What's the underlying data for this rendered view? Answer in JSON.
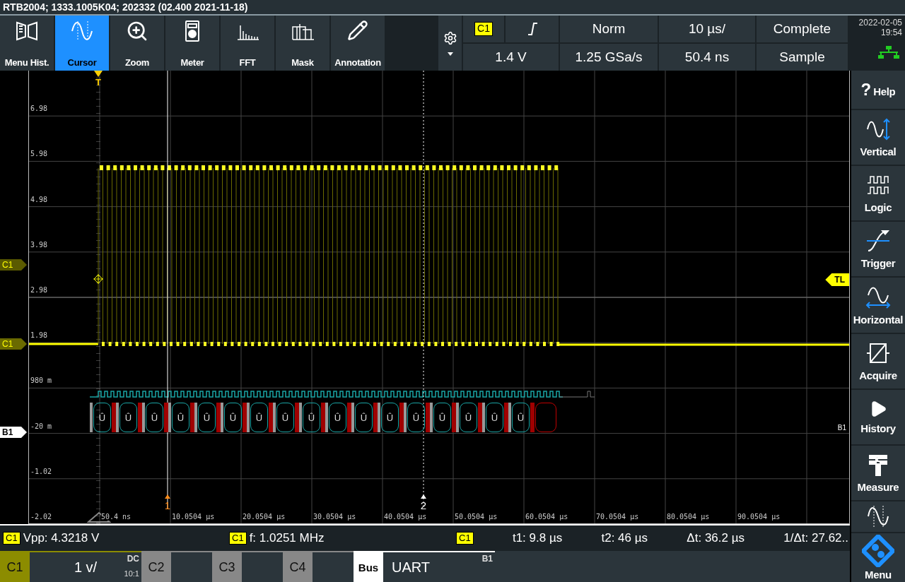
{
  "title_bar": {
    "text": "RTB2004; 1333.1005K04; 202332 (02.400 2021-11-18)"
  },
  "toolbar": {
    "tools": [
      {
        "label": "Menu Hist.",
        "selected": false
      },
      {
        "label": "Cursor",
        "selected": true
      },
      {
        "label": "Zoom",
        "selected": false
      },
      {
        "label": "Meter",
        "selected": false
      },
      {
        "label": "FFT",
        "selected": false
      },
      {
        "label": "Mask",
        "selected": false
      },
      {
        "label": "Annotation",
        "selected": false
      }
    ]
  },
  "acquisition": {
    "trigger_source": "C1",
    "trigger_mode": "Norm",
    "time_scale": "10 µs/",
    "acq_state": "Complete",
    "trigger_level": "1.4 V",
    "sample_rate": "1.25 GSa/s",
    "time_offset": "50.4 ns",
    "acq_mode": "Sample"
  },
  "clock": {
    "date": "2022-02-05",
    "time": "19:54"
  },
  "plot": {
    "y_labels": [
      "6.98",
      "5.98",
      "4.98",
      "3.98",
      "2.98",
      "1.98",
      "980 m",
      "-20 m",
      "-1.02",
      "-2.02"
    ],
    "x_labels": [
      "50.4 ns",
      "10.0504 µs",
      "20.0504 µs",
      "30.0504 µs",
      "40.0504 µs",
      "50.0504 µs",
      "60.0504 µs",
      "70.0504 µs",
      "80.0504 µs",
      "90.0504 µs"
    ],
    "trigger_marker": "T",
    "cursor_labels": [
      "1",
      "2"
    ],
    "left_markers": [
      {
        "label": "C1",
        "kind": "trigger"
      },
      {
        "label": "C1",
        "kind": "channel"
      },
      {
        "label": "B1",
        "kind": "bus"
      }
    ],
    "right_marker": "TL",
    "bus_label": "B1",
    "decode_frames": [
      {
        "kind": "byte",
        "text": "Û"
      },
      {
        "kind": "byte",
        "text": "Û"
      },
      {
        "kind": "byte",
        "text": "Û"
      },
      {
        "kind": "byte",
        "text": "Û"
      },
      {
        "kind": "byte",
        "text": "Û"
      },
      {
        "kind": "byte",
        "text": "Û"
      },
      {
        "kind": "byte",
        "text": "Û"
      },
      {
        "kind": "byte",
        "text": "Û"
      },
      {
        "kind": "byte",
        "text": "Û"
      },
      {
        "kind": "byte",
        "text": "Û"
      },
      {
        "kind": "byte",
        "text": "Û"
      },
      {
        "kind": "byte",
        "text": "Û"
      },
      {
        "kind": "byte",
        "text": "Û"
      },
      {
        "kind": "byte",
        "text": "Û"
      },
      {
        "kind": "byte",
        "text": "Û"
      },
      {
        "kind": "byte",
        "text": "Û"
      },
      {
        "kind": "byte",
        "text": "Û"
      },
      {
        "kind": "partial"
      }
    ]
  },
  "sidebar": {
    "items": [
      {
        "label": "Help",
        "glyph": "?"
      },
      {
        "label": "Vertical"
      },
      {
        "label": "Logic"
      },
      {
        "label": "Trigger"
      },
      {
        "label": "Horizontal"
      },
      {
        "label": "Acquire"
      },
      {
        "label": "History"
      },
      {
        "label": "Measure"
      }
    ],
    "menu": "Menu"
  },
  "measurements": [
    {
      "source": "C1",
      "text": "Vpp: 4.3218 V"
    },
    {
      "source": "C1",
      "text": "f: 1.0251 MHz"
    }
  ],
  "cursor_readout": {
    "source": "C1",
    "values": [
      "t1: 9.8 µs",
      "t2: 46 µs",
      "Δt: 36.2 µs",
      "1/Δt: 27.62.."
    ]
  },
  "channel_bar": {
    "channels": [
      {
        "label": "C1",
        "active": true,
        "scale": "1 v/",
        "coupling": "DC",
        "probe": "10:1"
      },
      {
        "label": "C2",
        "active": false
      },
      {
        "label": "C3",
        "active": false
      },
      {
        "label": "C4",
        "active": false
      }
    ],
    "bus": {
      "label": "Bus",
      "selected": true,
      "protocol": "UART",
      "name": "B1"
    }
  }
}
